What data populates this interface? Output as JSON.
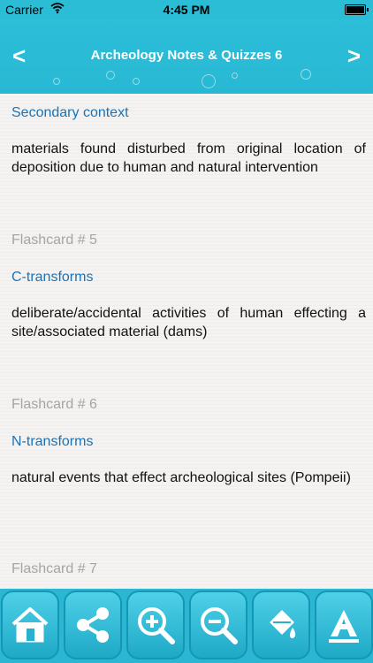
{
  "status": {
    "carrier": "Carrier",
    "time": "4:45 PM"
  },
  "nav": {
    "title": "Archeology Notes & Quizzes 6",
    "back_glyph": "<",
    "forward_glyph": ">"
  },
  "cards": [
    {
      "term": "Secondary context",
      "definition": "materials found disturbed from original location of deposition due to human and natural intervention"
    },
    {
      "flashcard": "Flashcard # 5",
      "term": "C-transforms",
      "definition": "deliberate/accidental activities of human effecting a site/associated material (dams)"
    },
    {
      "flashcard": "Flashcard # 6",
      "term": "N-transforms",
      "definition": "natural events that effect archeological sites (Pompeii)"
    },
    {
      "flashcard": "Flashcard # 7"
    }
  ],
  "toolbar": {
    "icons": [
      "home-icon",
      "share-icon",
      "zoom-in-icon",
      "zoom-out-icon",
      "paint-bucket-icon",
      "font-icon"
    ]
  },
  "colors": {
    "accent": "#2bbcd6",
    "term": "#1a73b8",
    "flashcard": "#a5a5a5"
  }
}
